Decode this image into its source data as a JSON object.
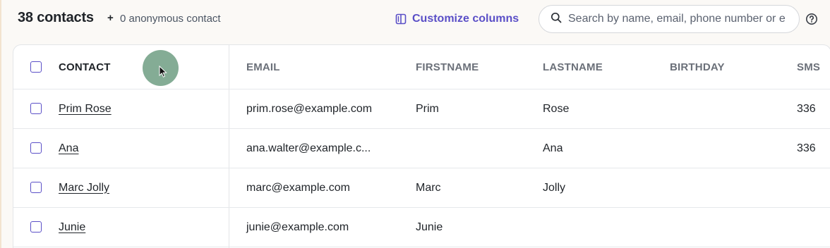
{
  "header": {
    "count_label": "38 contacts",
    "plus": "+",
    "anonymous_label": "0 anonymous contact",
    "customize_label": "Customize columns",
    "search_placeholder": "Search by name, email, phone number or e",
    "icons": {
      "customize": "columns-icon",
      "search": "search-icon",
      "help": "help-icon"
    },
    "accent_color": "#5a4fc7"
  },
  "table": {
    "columns": [
      "CONTACT",
      "EMAIL",
      "FIRSTNAME",
      "LASTNAME",
      "BIRTHDAY",
      "SMS"
    ],
    "rows": [
      {
        "contact": "Prim Rose",
        "email": "prim.rose@example.com",
        "firstname": "Prim",
        "lastname": "Rose",
        "birthday": "",
        "sms": "336"
      },
      {
        "contact": "Ana",
        "email": "ana.walter@example.c...",
        "firstname": "",
        "lastname": "Ana",
        "birthday": "",
        "sms": "336"
      },
      {
        "contact": "Marc Jolly",
        "email": "marc@example.com",
        "firstname": "Marc",
        "lastname": "Jolly",
        "birthday": "",
        "sms": ""
      },
      {
        "contact": "Junie",
        "email": "junie@example.com",
        "firstname": "Junie",
        "lastname": "",
        "birthday": "",
        "sms": ""
      }
    ]
  }
}
